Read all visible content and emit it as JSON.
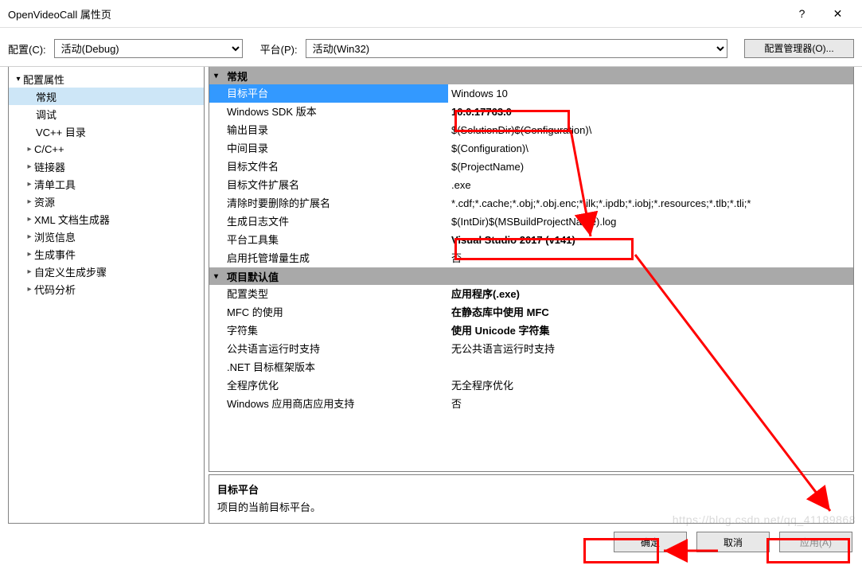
{
  "window": {
    "title": "OpenVideoCall 属性页",
    "help": "?",
    "close": "✕"
  },
  "toolbar": {
    "config_label": "配置(C):",
    "config_value": "活动(Debug)",
    "platform_label": "平台(P):",
    "platform_value": "活动(Win32)",
    "config_mgr": "配置管理器(O)..."
  },
  "tree": {
    "root": "配置属性",
    "items": [
      "常规",
      "调试",
      "VC++ 目录",
      "C/C++",
      "链接器",
      "清单工具",
      "资源",
      "XML 文档生成器",
      "浏览信息",
      "生成事件",
      "自定义生成步骤",
      "代码分析"
    ]
  },
  "g1": {
    "header": "常规",
    "r0": {
      "name": "目标平台",
      "value": "Windows 10"
    },
    "r1": {
      "name": "Windows SDK 版本",
      "value": "10.0.17763.0"
    },
    "r2": {
      "name": "输出目录",
      "value": "$(SolutionDir)$(Configuration)\\"
    },
    "r3": {
      "name": "中间目录",
      "value": "$(Configuration)\\"
    },
    "r4": {
      "name": "目标文件名",
      "value": "$(ProjectName)"
    },
    "r5": {
      "name": "目标文件扩展名",
      "value": ".exe"
    },
    "r6": {
      "name": "清除时要删除的扩展名",
      "value": "*.cdf;*.cache;*.obj;*.obj.enc;*.ilk;*.ipdb;*.iobj;*.resources;*.tlb;*.tli;*"
    },
    "r7": {
      "name": "生成日志文件",
      "value": "$(IntDir)$(MSBuildProjectName).log"
    },
    "r8": {
      "name": "平台工具集",
      "value": "Visual Studio 2017 (v141)"
    },
    "r9": {
      "name": "启用托管增量生成",
      "value": "否"
    }
  },
  "g2": {
    "header": "项目默认值",
    "r0": {
      "name": "配置类型",
      "value": "应用程序(.exe)"
    },
    "r1": {
      "name": "MFC 的使用",
      "value": "在静态库中使用 MFC"
    },
    "r2": {
      "name": "字符集",
      "value": "使用 Unicode 字符集"
    },
    "r3": {
      "name": "公共语言运行时支持",
      "value": "无公共语言运行时支持"
    },
    "r4": {
      "name": ".NET 目标框架版本",
      "value": ""
    },
    "r5": {
      "name": "全程序优化",
      "value": "无全程序优化"
    },
    "r6": {
      "name": "Windows 应用商店应用支持",
      "value": "否"
    }
  },
  "desc": {
    "title": "目标平台",
    "text": "项目的当前目标平台。"
  },
  "buttons": {
    "ok": "确定",
    "cancel": "取消",
    "apply": "应用(A)"
  },
  "watermark": "https://blog.csdn.net/qq_41189868"
}
